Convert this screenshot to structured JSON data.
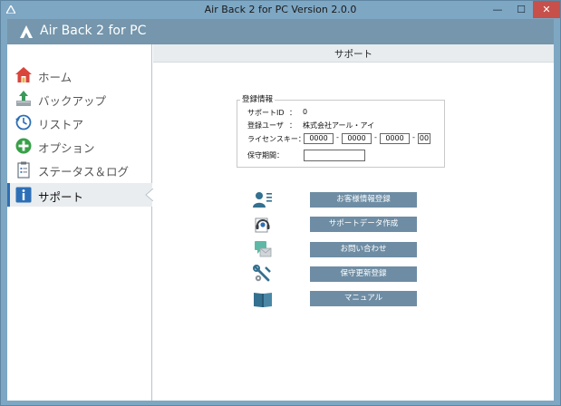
{
  "window": {
    "title": "Air Back 2 for PC Version 2.0.0",
    "buttons": {
      "minimize": "—",
      "maximize": "☐",
      "close": "✕"
    }
  },
  "app": {
    "name": "Air Back 2 for PC"
  },
  "sidebar": {
    "items": [
      {
        "label": "ホーム",
        "icon": "home-icon"
      },
      {
        "label": "バックアップ",
        "icon": "backup-icon"
      },
      {
        "label": "リストア",
        "icon": "restore-icon"
      },
      {
        "label": "オプション",
        "icon": "options-icon"
      },
      {
        "label": "ステータス＆ログ",
        "icon": "status-log-icon"
      },
      {
        "label": "サポート",
        "icon": "info-icon",
        "active": true
      }
    ]
  },
  "page": {
    "title": "サポート",
    "registration": {
      "legend": "登録情報",
      "support_id_label": "サポートID",
      "support_id_colon": "：",
      "support_id_value": "0",
      "user_label": "登録ユーザ",
      "user_colon": "：",
      "user_value": "株式会社アール・アイ",
      "license_label": "ライセンスキー：",
      "license_parts": [
        "0000",
        "0000",
        "0000",
        "00"
      ],
      "license_sep": "-",
      "term_label": "保守期間：",
      "term_value": ""
    },
    "actions": [
      {
        "label": "お客様情報登録",
        "icon": "customer-info-icon"
      },
      {
        "label": "サポートデータ作成",
        "icon": "support-headset-icon"
      },
      {
        "label": "お問い合わせ",
        "icon": "inquiry-chat-icon"
      },
      {
        "label": "保守更新登録",
        "icon": "maintenance-tools-icon"
      },
      {
        "label": "マニュアル",
        "icon": "manual-book-icon"
      }
    ]
  },
  "colors": {
    "titlebar": "#7ea7c4",
    "header": "#7596ac",
    "button": "#6e8da4",
    "close": "#c7504a",
    "active_bar": "#2d6fb6"
  }
}
